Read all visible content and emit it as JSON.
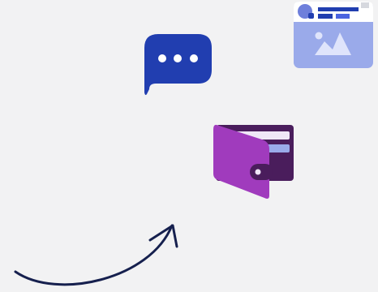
{
  "colors": {
    "background": "#f2f2f3",
    "chat_bubble": "#213eb0",
    "chat_dots": "#ffffff",
    "card_body": "#9aaaea",
    "card_header": "#ffffff",
    "card_avatar": "#6e7fdb",
    "card_text_dark": "#213eb0",
    "card_text_light": "#4a63e0",
    "card_image_art": "#dfe4fb",
    "card_corner_tab": "#d6d8de",
    "wallet_back": "#4a1d5c",
    "wallet_front": "#a03bbd",
    "wallet_card_light": "#efe7f7",
    "wallet_card_blue": "#9aaaea",
    "wallet_clasp": "#4a1d5c",
    "wallet_button": "#efe7f7",
    "arrow": "#16204e"
  },
  "icons": {
    "chat": "chat-bubble-icon",
    "card": "post-card-icon",
    "wallet": "wallet-icon",
    "arrow": "curved-arrow-icon"
  }
}
